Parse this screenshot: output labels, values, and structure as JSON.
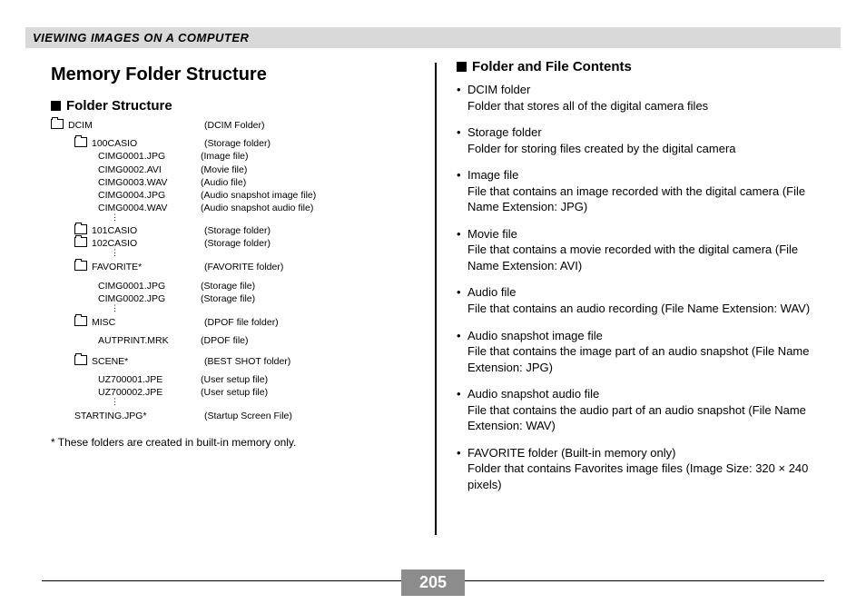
{
  "header": "VIEWING IMAGES ON A COMPUTER",
  "title": "Memory Folder Structure",
  "section_folder_structure": "Folder Structure",
  "section_contents": "Folder and File Contents",
  "page_number": "205",
  "footnote": "* These folders are created in built-in memory only.",
  "tree": {
    "dcim": {
      "name": "DCIM",
      "desc": "(DCIM Folder)"
    },
    "f100": {
      "name": "100CASIO",
      "desc": "(Storage folder)"
    },
    "i1": {
      "name": "CIMG0001.JPG",
      "desc": "(Image file)"
    },
    "i2": {
      "name": "CIMG0002.AVI",
      "desc": "(Movie file)"
    },
    "i3": {
      "name": "CIMG0003.WAV",
      "desc": "(Audio file)"
    },
    "i4": {
      "name": "CIMG0004.JPG",
      "desc": "(Audio snapshot image file)"
    },
    "i5": {
      "name": "CIMG0004.WAV",
      "desc": "(Audio snapshot audio file)"
    },
    "f101": {
      "name": "101CASIO",
      "desc": "(Storage folder)"
    },
    "f102": {
      "name": "102CASIO",
      "desc": "(Storage folder)"
    },
    "fav": {
      "name": "FAVORITE*",
      "desc": "(FAVORITE folder)"
    },
    "fav1": {
      "name": "CIMG0001.JPG",
      "desc": "(Storage file)"
    },
    "fav2": {
      "name": "CIMG0002.JPG",
      "desc": "(Storage file)"
    },
    "misc": {
      "name": "MISC",
      "desc": "(DPOF file folder)"
    },
    "aut": {
      "name": "AUTPRINT.MRK",
      "desc": "(DPOF file)"
    },
    "scene": {
      "name": "SCENE*",
      "desc": "(BEST SHOT folder)"
    },
    "uz1": {
      "name": "UZ700001.JPE",
      "desc": "(User setup file)"
    },
    "uz2": {
      "name": "UZ700002.JPE",
      "desc": "(User setup file)"
    },
    "start": {
      "name": "STARTING.JPG*",
      "desc": "(Startup Screen File)"
    }
  },
  "contents": [
    {
      "t": "DCIM folder",
      "d": "Folder that stores all of the digital camera files"
    },
    {
      "t": "Storage folder",
      "d": "Folder for storing files created by the digital camera"
    },
    {
      "t": "Image file",
      "d": "File that contains an image recorded with the digital camera (File Name Extension: JPG)"
    },
    {
      "t": "Movie file",
      "d": "File that contains a movie recorded with the digital camera (File Name Extension: AVI)"
    },
    {
      "t": "Audio file",
      "d": "File that contains an audio recording (File Name Extension: WAV)"
    },
    {
      "t": "Audio snapshot image file",
      "d": "File that contains the image part of an audio snapshot (File Name Extension: JPG)"
    },
    {
      "t": "Audio snapshot audio file",
      "d": "File that contains the audio part of an audio snapshot (File Name Extension: WAV)"
    },
    {
      "t": "FAVORITE folder (Built-in memory only)",
      "d": "Folder that contains Favorites image files (Image Size: 320 × 240 pixels)"
    }
  ]
}
